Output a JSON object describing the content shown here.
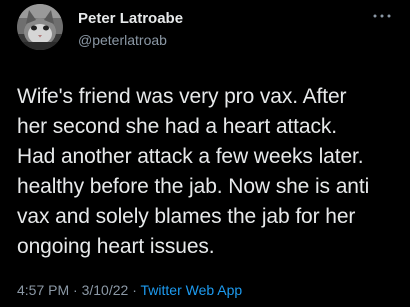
{
  "tweet": {
    "author": {
      "display_name": "Peter Latroabe",
      "handle": "@peterlatroab",
      "avatar_icon": "cat-avatar"
    },
    "more_icon": "more-options-icon",
    "text": "Wife's friend was very pro vax. After\nher second she had a heart attack.\nHad another attack a few weeks later.\nhealthy before the jab. Now she is anti\nvax and solely blames the jab for her\nongoing heart issues.",
    "time": "4:57 PM",
    "date": "3/10/22",
    "separator": "·",
    "source": "Twitter Web App"
  },
  "colors": {
    "background": "#000000",
    "primary_text": "#e7e9ea",
    "secondary_text": "#8b98a5",
    "link": "#1d9bf0"
  }
}
